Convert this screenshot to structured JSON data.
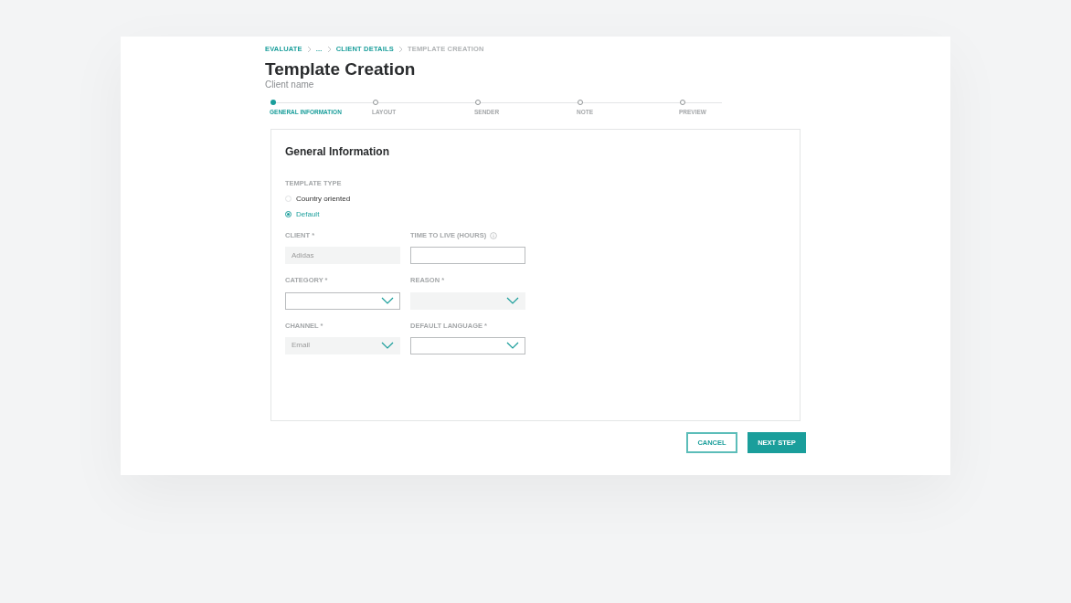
{
  "breadcrumbs": [
    {
      "label": "EVALUATE",
      "current": false
    },
    {
      "label": "...",
      "current": false
    },
    {
      "label": "CLIENT DETAILS",
      "current": false
    },
    {
      "label": "TEMPLATE CREATION",
      "current": true
    }
  ],
  "title": "Template Creation",
  "subtitle": "Client name",
  "steps": [
    {
      "label": "GENERAL INFORMATION",
      "selected": true
    },
    {
      "label": "LAYOUT",
      "selected": false
    },
    {
      "label": "SENDER",
      "selected": false
    },
    {
      "label": "NOTE",
      "selected": false
    },
    {
      "label": "PREVIEW",
      "selected": false
    }
  ],
  "form": {
    "heading": "General Information",
    "template_type": {
      "label": "TEMPLATE TYPE",
      "options": [
        {
          "label": "Country oriented",
          "selected": false
        },
        {
          "label": "Default",
          "selected": true
        }
      ]
    },
    "fields": [
      {
        "kind": "text",
        "label": "CLIENT *",
        "value": "Adidas",
        "disabled": true,
        "info": false
      },
      {
        "kind": "text",
        "label": "TIME TO LIVE (HOURS)",
        "disabled": false,
        "info": true
      },
      {
        "kind": "select",
        "label": "CATEGORY *",
        "disabled": false,
        "info": false
      },
      {
        "kind": "select",
        "label": "REASON *",
        "disabled": true,
        "info": false
      },
      {
        "kind": "select",
        "label": "CHANNEL *",
        "value": "Email",
        "disabled": true,
        "info": false
      },
      {
        "kind": "select",
        "label": "DEFAULT LANGUAGE *",
        "disabled": false,
        "info": false
      }
    ]
  },
  "buttons": [
    {
      "label": "CANCEL",
      "kind": "secondary"
    },
    {
      "label": "NEXT STEP",
      "kind": "primary"
    }
  ]
}
